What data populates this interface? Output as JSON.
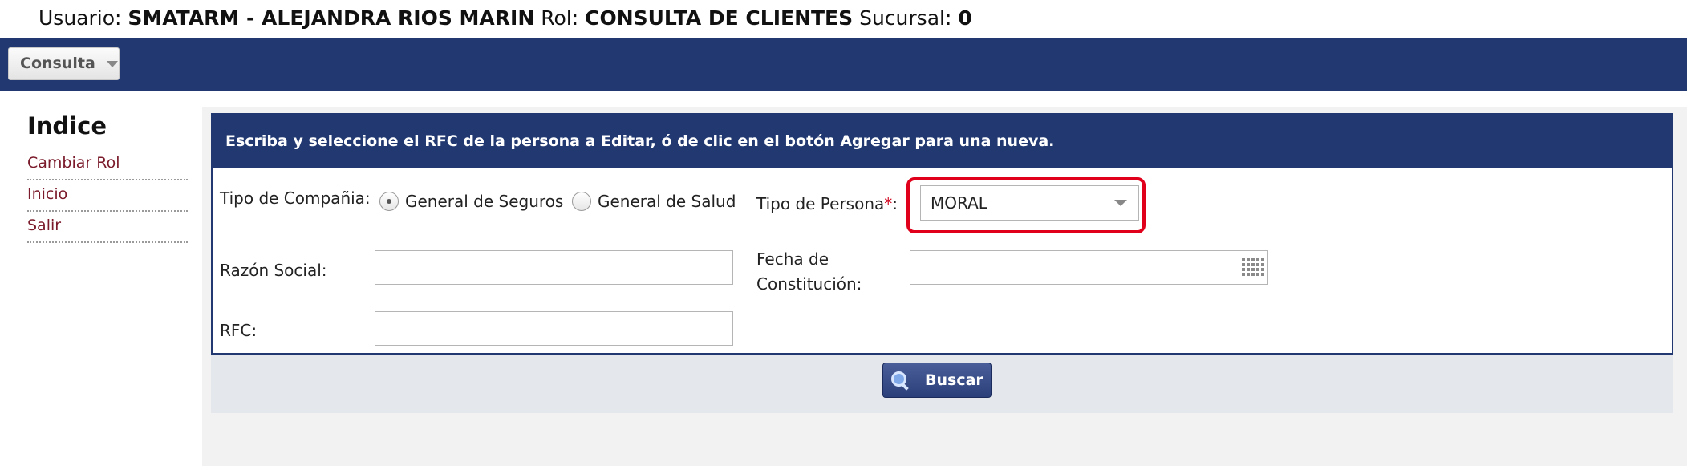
{
  "user_bar": {
    "usuario_label": "Usuario:",
    "usuario_value": "SMATARM - ALEJANDRA RIOS MARIN",
    "rol_label": "Rol:",
    "rol_value": "CONSULTA DE CLIENTES",
    "sucursal_label": "Sucursal:",
    "sucursal_value": "0"
  },
  "navbar": {
    "menu_label": "Consulta"
  },
  "sidebar": {
    "title": "Indice",
    "items": [
      {
        "label": "Cambiar Rol"
      },
      {
        "label": "Inicio"
      },
      {
        "label": "Salir"
      }
    ]
  },
  "form": {
    "header": "Escriba y seleccione el RFC de la persona a Editar, ó de clic en el botón Agregar para una nueva.",
    "tipo_compania_label": "Tipo de Compañia:",
    "tipo_compania_options": [
      {
        "label": "General de Seguros",
        "selected": true
      },
      {
        "label": "General de Salud",
        "selected": false
      }
    ],
    "tipo_persona_label": "Tipo de Persona",
    "tipo_persona_required": "*",
    "tipo_persona_colon": ":",
    "tipo_persona_value": "MORAL",
    "razon_social_label": "Razón Social:",
    "razon_social_value": "",
    "fecha_label_line1": "Fecha de",
    "fecha_label_line2": "Constitución:",
    "fecha_value": "",
    "rfc_label": "RFC:",
    "rfc_value": "",
    "search_button": "Buscar"
  },
  "colors": {
    "navy": "#213871",
    "link": "#7a1a2a",
    "highlight": "#e0001b"
  }
}
